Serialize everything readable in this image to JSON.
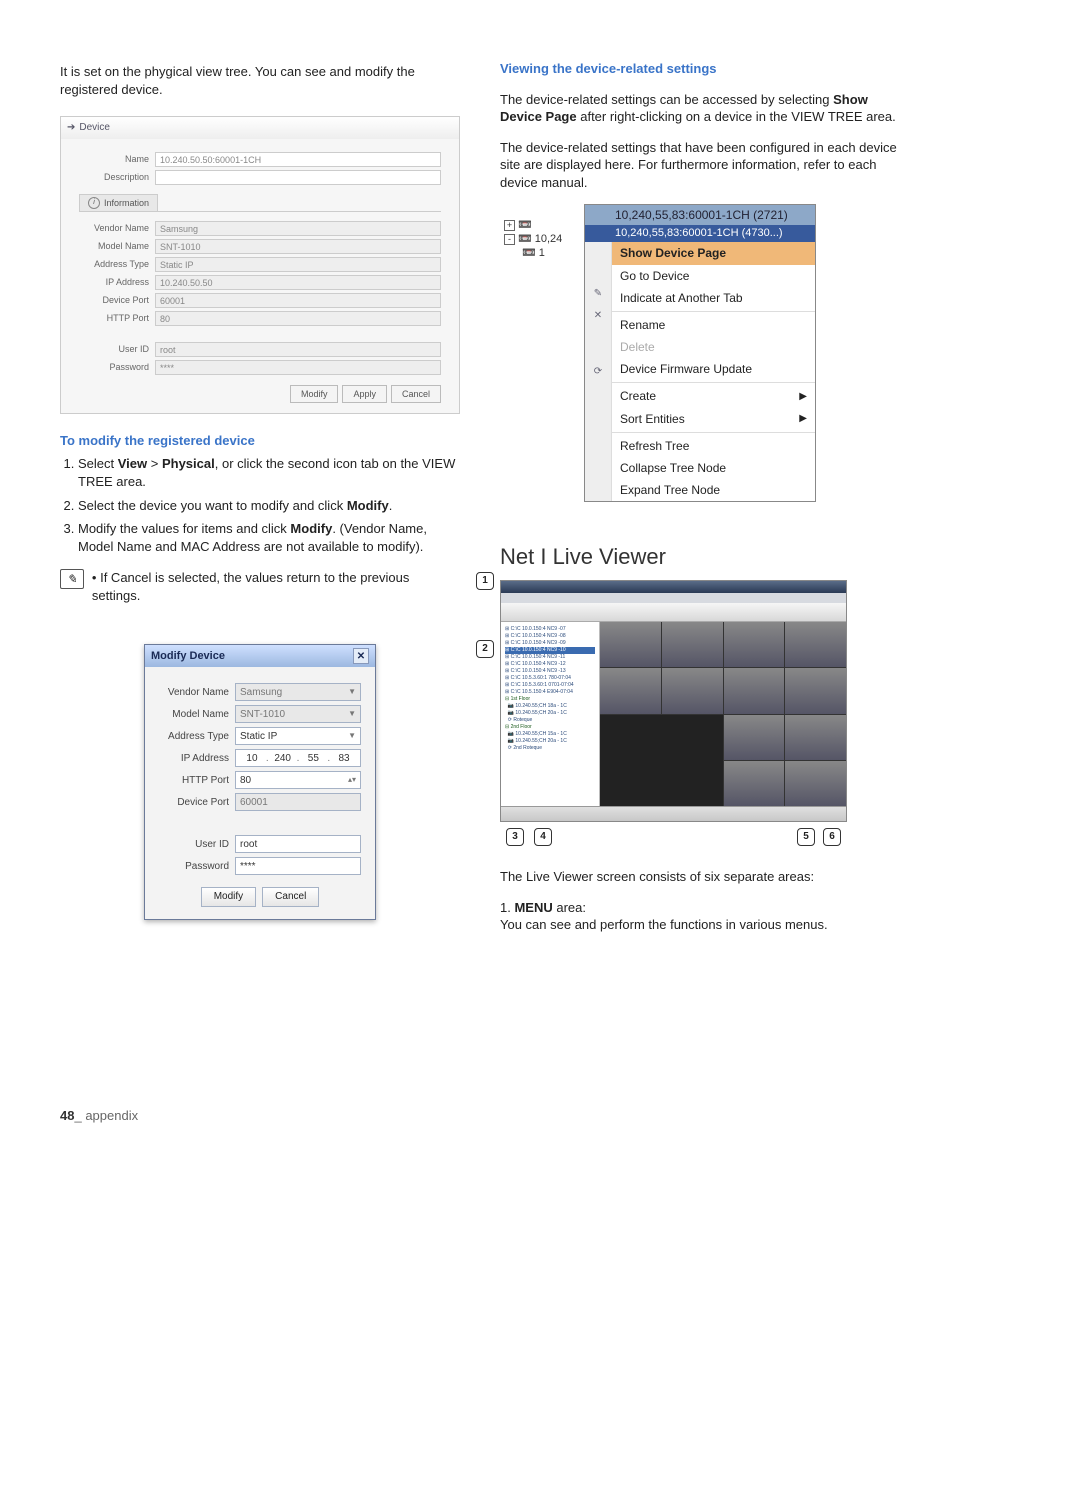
{
  "left": {
    "intro": "It is set on the phygical view tree. You can see and modify the registered device.",
    "panel": {
      "title": "Device",
      "name_label": "Name",
      "name_value": "10.240.50.50:60001-1CH",
      "description_label": "Description",
      "info_tab": "Information",
      "vendor_label": "Vendor Name",
      "vendor_value": "Samsung",
      "model_label": "Model Name",
      "model_value": "SNT-1010",
      "addrtype_label": "Address Type",
      "addrtype_value": "Static IP",
      "ip_label": "IP Address",
      "ip_value": "10.240.50.50",
      "devport_label": "Device Port",
      "devport_value": "60001",
      "httpport_label": "HTTP Port",
      "httpport_value": "80",
      "userid_label": "User ID",
      "userid_value": "root",
      "password_label": "Password",
      "password_value": "****",
      "btn_modify": "Modify",
      "btn_apply": "Apply",
      "btn_cancel": "Cancel"
    },
    "modify_title": "To modify the registered device",
    "step1_pre": "Select ",
    "step1_b1": "View",
    "step1_mid": " > ",
    "step1_b2": "Physical",
    "step1_post": ", or click the second icon tab on the VIEW TREE area.",
    "step2_pre": "Select the device you want to modify and click ",
    "step2_b": "Modify",
    "step2_post": ".",
    "step3_pre": "Modify the values for items and click ",
    "step3_b": "Modify",
    "step3_post": ". (Vendor Name, Model Name and MAC Address are not available to modify).",
    "note": "If Cancel is selected, the values return to the previous settings.",
    "dialog": {
      "title": "Modify Device",
      "vendor_label": "Vendor Name",
      "vendor_value": "Samsung",
      "model_label": "Model Name",
      "model_value": "SNT-1010",
      "addrtype_label": "Address Type",
      "addrtype_value": "Static IP",
      "ip_label": "IP Address",
      "ip_a": "10",
      "ip_b": "240",
      "ip_c": "55",
      "ip_d": "83",
      "httpport_label": "HTTP Port",
      "httpport_value": "80",
      "devport_label": "Device Port",
      "devport_value": "60001",
      "userid_label": "User ID",
      "userid_value": "root",
      "password_label": "Password",
      "password_value": "****",
      "btn_modify": "Modify",
      "btn_cancel": "Cancel"
    }
  },
  "right": {
    "view_title": "Viewing the device-related settings",
    "view_p1a": "The device-related settings can be accessed by selecting ",
    "view_p1b": "Show Device Page",
    "view_p1c": " after right-clicking on a device in the VIEW TREE area.",
    "view_p2": "The device-related settings that have been configured in each device site are displayed here. For furthermore information, refer to each device manual.",
    "tree": {
      "line1": "10,240,55,83:60001-1CH (2721)",
      "line2": "10,240,55,83:60001-1CH (4730...)",
      "line3": "10,24",
      "line4": "1"
    },
    "menu": {
      "show": "Show Device Page",
      "go": "Go to Device",
      "indicate": "Indicate at Another Tab",
      "rename": "Rename",
      "delete": "Delete",
      "fw": "Device Firmware Update",
      "create": "Create",
      "sort": "Sort Entities",
      "refresh": "Refresh Tree",
      "collapse": "Collapse Tree Node",
      "expand": "Expand Tree Node"
    },
    "viewer_heading": "Net I Live Viewer",
    "viewer_desc": "The Live Viewer screen consists of six separate areas:",
    "viewer_item1_pre": "1. ",
    "viewer_item1_b": "MENU",
    "viewer_item1_post": " area:",
    "viewer_item1_desc": "You can see and perform the functions in various menus.",
    "callouts": {
      "c1": "1",
      "c2": "2",
      "c3": "3",
      "c4": "4",
      "c5": "5",
      "c6": "6"
    }
  },
  "footer": {
    "page": "48",
    "sep": "_ ",
    "section": "appendix"
  }
}
